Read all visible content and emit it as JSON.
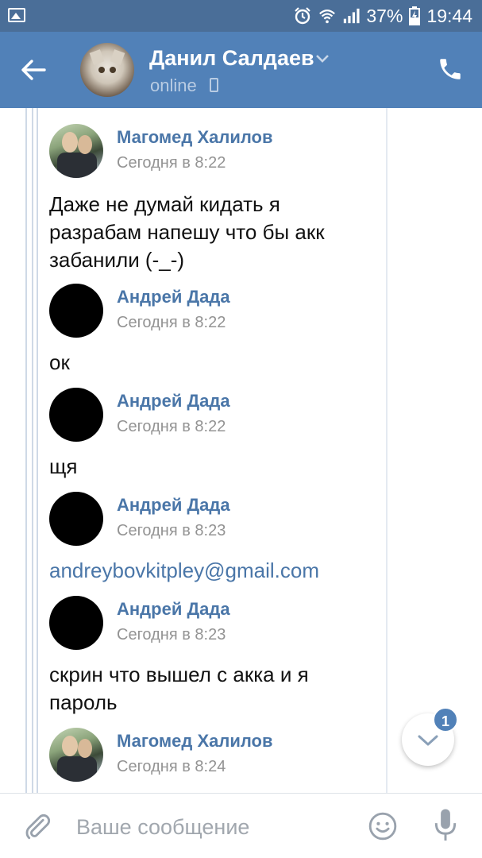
{
  "status_bar": {
    "battery": "37%",
    "time": "19:44"
  },
  "header": {
    "contact_name": "Данил Салдаев",
    "status": "online"
  },
  "chat": {
    "top_cut_text": "",
    "messages": [
      {
        "author": "Магомед Халилов",
        "time": "Сегодня в 8:22",
        "text": "Даже не думай кидать я разрабам напешу что бы акк забанили (-_-)"
      },
      {
        "author": "Андрей Дада",
        "time": "Сегодня в 8:22",
        "text": "ок"
      },
      {
        "author": "Андрей Дада",
        "time": "Сегодня в 8:22",
        "text": "щя"
      },
      {
        "author": "Андрей Дада",
        "time": "Сегодня в 8:23",
        "text": "andreybovkitpley@gmail.com"
      },
      {
        "author": "Андрей Дада",
        "time": "Сегодня в 8:23",
        "text": "скрин что вышел с акка и я пароль"
      },
      {
        "author": "Магомед Халилов",
        "time": "Сегодня в 8:24",
        "text": ""
      }
    ]
  },
  "fab": {
    "unread_count": "1"
  },
  "input": {
    "placeholder": "Ваше сообщение"
  },
  "colors": {
    "header_bg": "#5181b8",
    "status_bg": "#4a6e98",
    "author": "#4a76a8",
    "time": "#939393"
  },
  "icons": [
    "gallery-icon",
    "alarm-icon",
    "wifi-icon",
    "signal-icon",
    "battery-icon",
    "back-arrow-icon",
    "chevron-down-icon",
    "mobile-icon",
    "phone-icon",
    "attach-icon",
    "emoji-icon",
    "mic-icon"
  ]
}
